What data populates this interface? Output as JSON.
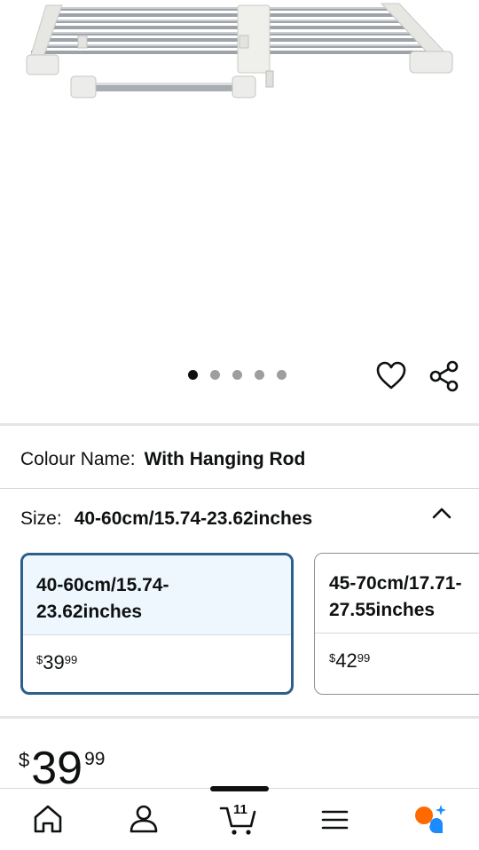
{
  "product_image": {
    "description_icon": "expandable-shelf-rack"
  },
  "carousel": {
    "total": 5,
    "active_index": 0
  },
  "actions": {
    "wishlist_icon": "heart-icon",
    "share_icon": "share-icon"
  },
  "colour": {
    "label": "Colour Name:",
    "value": "With Hanging Rod"
  },
  "size": {
    "label": "Size:",
    "value": "40-60cm/15.74-23.62inches",
    "options": [
      {
        "label": "40-60cm/15.74-\n23.62inches",
        "currency": "$",
        "price_whole": "39",
        "price_fraction": "99",
        "selected": true
      },
      {
        "label": "45-70cm/17.71-\n27.55inches",
        "currency": "$",
        "price_whole": "42",
        "price_fraction": "99",
        "selected": false
      }
    ]
  },
  "price": {
    "currency": "$",
    "whole": "39",
    "fraction": "99"
  },
  "bottom_nav": {
    "items": [
      "home-icon",
      "account-icon",
      "cart-icon",
      "menu-icon",
      "assistant-icon"
    ],
    "cart_count": "11",
    "accent_colors": {
      "assistant_orange": "#ff6a00",
      "assistant_blue": "#1a8cff"
    }
  }
}
